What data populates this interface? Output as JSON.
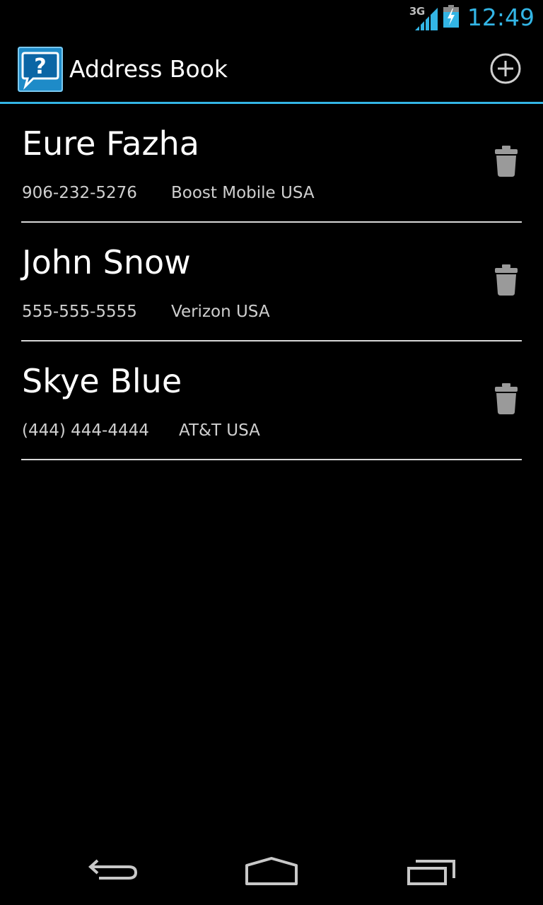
{
  "status_bar": {
    "network_type": "3G",
    "signal_icon": "signal-strength-icon",
    "battery_icon": "battery-charging-icon",
    "time": "12:49"
  },
  "action_bar": {
    "app_icon": "question-speech-bubble-icon",
    "title": "Address Book",
    "add_icon": "add-circle-icon"
  },
  "contacts": [
    {
      "name": "Eure Fazha",
      "phone": "906-232-5276",
      "carrier": "Boost Mobile USA",
      "delete_icon": "trash-icon"
    },
    {
      "name": "John Snow",
      "phone": "555-555-5555",
      "carrier": "Verizon USA",
      "delete_icon": "trash-icon"
    },
    {
      "name": "Skye Blue",
      "phone": "(444) 444-4444",
      "carrier": "AT&T USA",
      "delete_icon": "trash-icon"
    }
  ],
  "nav_bar": {
    "back_icon": "back-icon",
    "home_icon": "home-icon",
    "recents_icon": "recent-apps-icon"
  },
  "colors": {
    "accent": "#33b5e5",
    "background": "#000000",
    "divider": "#d8d8d8",
    "icon_gray": "#9a9a9a"
  }
}
